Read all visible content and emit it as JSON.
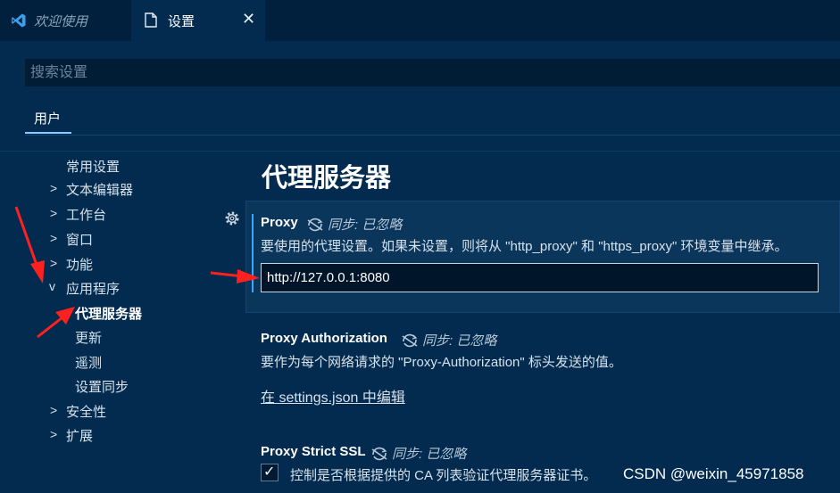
{
  "tabs": {
    "welcome": "欢迎使用",
    "settings": "设置",
    "close_glyph": "✕"
  },
  "search": {
    "placeholder": "搜索设置"
  },
  "scope": {
    "user": "用户"
  },
  "toc": [
    {
      "label": "常用设置",
      "chevron": ""
    },
    {
      "label": "文本编辑器",
      "chevron": ">"
    },
    {
      "label": "工作台",
      "chevron": ">"
    },
    {
      "label": "窗口",
      "chevron": ">"
    },
    {
      "label": "功能",
      "chevron": ">"
    },
    {
      "label": "应用程序",
      "chevron": "v"
    },
    {
      "label": "代理服务器",
      "chevron": ""
    },
    {
      "label": "更新",
      "chevron": ""
    },
    {
      "label": "遥测",
      "chevron": ""
    },
    {
      "label": "设置同步",
      "chevron": ""
    },
    {
      "label": "安全性",
      "chevron": ">"
    },
    {
      "label": "扩展",
      "chevron": ">"
    }
  ],
  "section_title": "代理服务器",
  "settings": {
    "proxy": {
      "title": "Proxy",
      "sync": "同步: 已忽略",
      "description": "要使用的代理设置。如果未设置，则将从 \"http_proxy\" 和 \"https_proxy\" 环境变量中继承。",
      "value": "http://127.0.0.1:8080"
    },
    "proxy_auth": {
      "title": "Proxy Authorization",
      "sync": "同步: 已忽略",
      "description": "要作为每个网络请求的 \"Proxy-Authorization\" 标头发送的值。",
      "edit_link": "在 settings.json 中编辑"
    },
    "proxy_ssl": {
      "title": "Proxy Strict SSL",
      "sync": "同步: 已忽略",
      "description": "控制是否根据提供的 CA 列表验证代理服务器证书。",
      "checked": true
    }
  },
  "watermark": "CSDN @weixin_45971858",
  "colors": {
    "background": "#022b4f",
    "accent": "#3aa7ff",
    "annotation_arrow": "#ff2020"
  }
}
